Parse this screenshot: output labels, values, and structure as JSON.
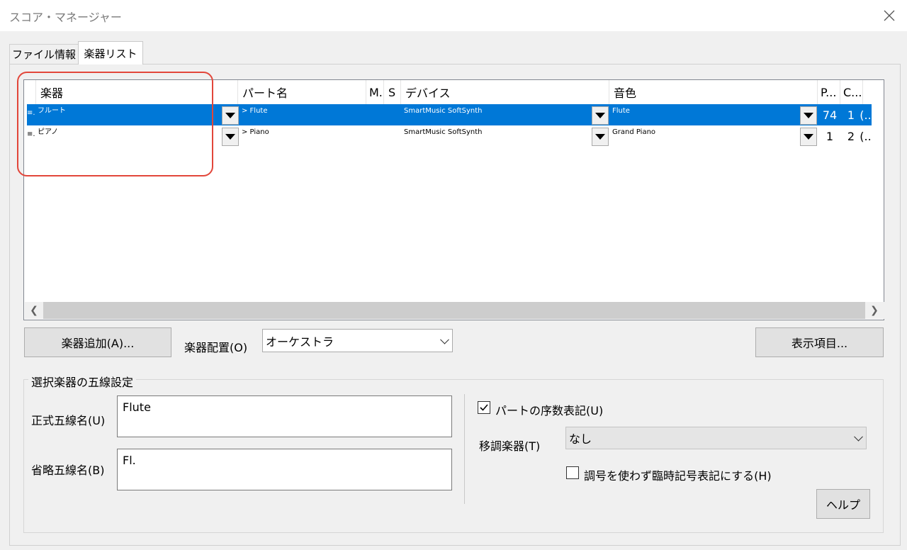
{
  "window": {
    "title": "スコア・マネージャー"
  },
  "tabs": [
    {
      "label": "ファイル情報",
      "active": false
    },
    {
      "label": "楽器リスト",
      "active": true
    }
  ],
  "grid": {
    "columns": [
      "楽器",
      "パート名",
      "M.",
      "S",
      "デバイス",
      "音色",
      "P...",
      "C..."
    ],
    "rows": [
      {
        "grip": "≡.",
        "instrument": "フルート",
        "part": "> Flute",
        "device": "SmartMusic SoftSynth",
        "sound": "Flute",
        "p": "74",
        "c": "1",
        "tail": "(..",
        "selected": true
      },
      {
        "grip": "≡.",
        "instrument": "ピアノ",
        "part": "> Piano",
        "device": "SmartMusic SoftSynth",
        "sound": "Grand Piano",
        "p": "1",
        "c": "2",
        "tail": "(..",
        "selected": false
      }
    ]
  },
  "toolbar": {
    "add_label": "楽器追加(A)...",
    "layout_label": "楽器配置(O)",
    "layout_value": "オーケストラ",
    "display_items_label": "表示項目..."
  },
  "staff_settings": {
    "title": "選択楽器の五線設定",
    "full_name_label": "正式五線名(U)",
    "full_name_value": "Flute",
    "abbr_name_label": "省略五線名(B)",
    "abbr_name_value": "Fl.",
    "ordinal_label": "パートの序数表記(U)",
    "ordinal_checked": true,
    "transpose_label": "移調楽器(T)",
    "transpose_value": "なし",
    "no_key_label": "調号を使わず臨時記号表記にする(H)",
    "no_key_checked": false,
    "help_label": "ヘルプ"
  },
  "colors": {
    "selection": "#0078d7",
    "highlight": "#e2463a"
  }
}
